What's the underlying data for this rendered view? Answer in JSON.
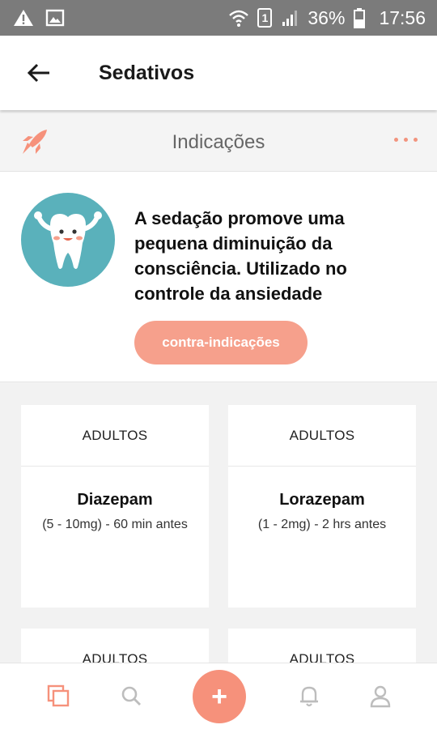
{
  "status_bar": {
    "battery": "36%",
    "time": "17:56",
    "sim": "1",
    "icons": [
      "warning-icon",
      "image-icon",
      "wifi-icon",
      "sim-icon",
      "signal-icon",
      "battery-icon"
    ]
  },
  "app_bar": {
    "title": "Sedativos",
    "back_icon": "arrow-left-icon"
  },
  "section": {
    "title": "Indicações",
    "left_icon": "rocket-icon",
    "right_icon": "more-horizontal-icon"
  },
  "intro": {
    "avatar_icon": "tooth-mascot-icon",
    "text": "A sedação promove uma pequena diminuição da consciência. Utilizado no controle da ansiedade",
    "button_label": "contra-indicações"
  },
  "cards": [
    {
      "header": "ADULTOS",
      "name": "Diazepam",
      "dose": "(5 - 10mg) - 60 min antes"
    },
    {
      "header": "ADULTOS",
      "name": "Lorazepam",
      "dose": "(1 - 2mg) - 2 hrs antes"
    },
    {
      "header": "ADULTOS",
      "name": "",
      "dose": ""
    },
    {
      "header": "ADULTOS",
      "name": "",
      "dose": ""
    }
  ],
  "bottom_nav": {
    "items": [
      "copy-icon",
      "search-icon",
      "plus-icon",
      "bell-icon",
      "user-icon"
    ],
    "fab_label": "+"
  },
  "colors": {
    "accent": "#f6917b",
    "status_bar": "#7b7b7b",
    "teal": "#5ab1bb"
  }
}
